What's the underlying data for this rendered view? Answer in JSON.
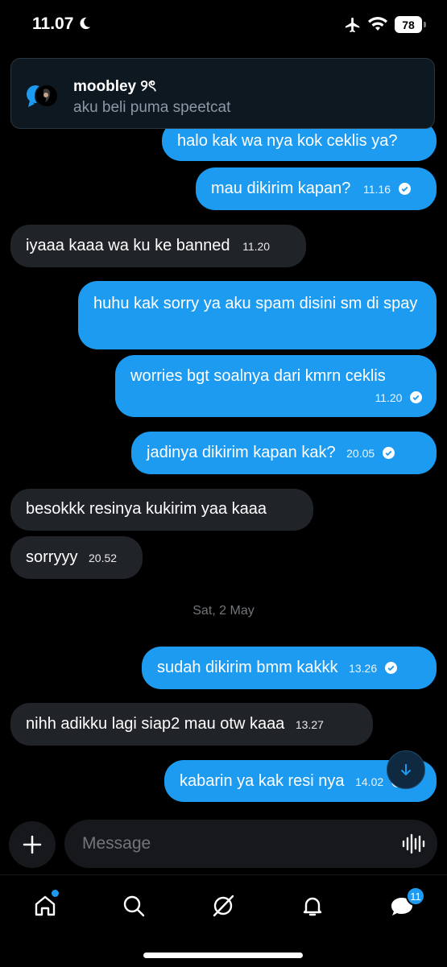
{
  "status": {
    "time": "11.07",
    "battery": "78"
  },
  "notification": {
    "title": "moobley ୨ৎ",
    "body": "aku beli puma speetcat"
  },
  "messages": [
    {
      "text": "halo kak wa nya kok ceklis ya?",
      "time": ""
    },
    {
      "text": "mau dikirim kapan?",
      "time": "11.16"
    },
    {
      "text": "iyaaa kaaa wa ku ke banned",
      "time": "11.20"
    },
    {
      "text": "huhu kak sorry ya aku spam disini sm di spay",
      "time": ""
    },
    {
      "text": "worries bgt soalnya dari kmrn ceklis",
      "time": "11.20"
    },
    {
      "text": "jadinya dikirim kapan kak?",
      "time": "20.05"
    },
    {
      "text": "besokkk resinya kukirim yaa kaaa",
      "time": ""
    },
    {
      "text": "sorryyy",
      "time": "20.52"
    },
    {
      "text": "sudah dikirim bmm kakkk",
      "time": "13.26"
    },
    {
      "text": "nihh adikku lagi siap2 mau otw kaaa",
      "time": "13.27"
    },
    {
      "text": "kabarin ya kak resi nya",
      "time": "14.02"
    }
  ],
  "date_separator": "Sat, 2 May",
  "composer": {
    "placeholder": "Message"
  },
  "tabs": {
    "messages_badge": "11"
  },
  "colors": {
    "accent": "#1d9bf0",
    "incoming": "#202327",
    "background": "#000000"
  }
}
